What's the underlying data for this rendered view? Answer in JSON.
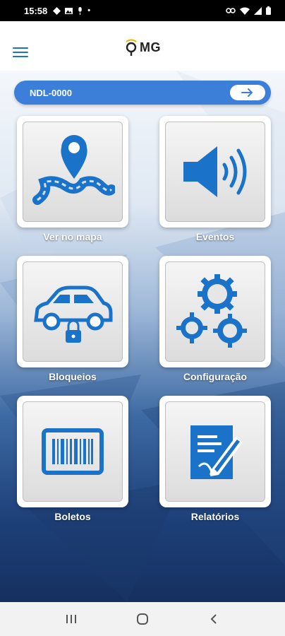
{
  "status": {
    "time": "15:58"
  },
  "header": {
    "logo_text": "MG"
  },
  "vehicle": {
    "plate": "NDL-0000"
  },
  "tiles": [
    {
      "label": "Ver no mapa",
      "icon": "map-pin-icon"
    },
    {
      "label": "Eventos",
      "icon": "speaker-icon"
    },
    {
      "label": "Bloqueios",
      "icon": "car-lock-icon"
    },
    {
      "label": "Configuração",
      "icon": "gears-icon"
    },
    {
      "label": "Boletos",
      "icon": "barcode-icon"
    },
    {
      "label": "Relatórios",
      "icon": "report-icon"
    }
  ],
  "colors": {
    "accent": "#1a73c8",
    "bar": "#3c7fd8"
  }
}
